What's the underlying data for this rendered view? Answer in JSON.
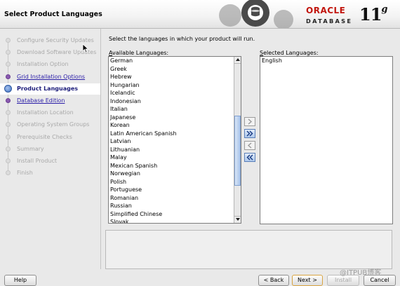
{
  "header": {
    "title": "Select Product Languages",
    "logo_oracle": "ORACLE",
    "logo_database": "DATABASE",
    "logo_version": "11",
    "logo_version_suffix": "g"
  },
  "steps": [
    {
      "label": "Configure Security Updates",
      "state": "disabled"
    },
    {
      "label": "Download Software Updates",
      "state": "disabled"
    },
    {
      "label": "Installation Option",
      "state": "disabled"
    },
    {
      "label": "Grid Installation Options",
      "state": "link"
    },
    {
      "label": "Product Languages",
      "state": "current"
    },
    {
      "label": "Database Edition",
      "state": "link"
    },
    {
      "label": "Installation Location",
      "state": "disabled"
    },
    {
      "label": "Operating System Groups",
      "state": "disabled"
    },
    {
      "label": "Prerequisite Checks",
      "state": "disabled"
    },
    {
      "label": "Summary",
      "state": "disabled"
    },
    {
      "label": "Install Product",
      "state": "disabled"
    },
    {
      "label": "Finish",
      "state": "disabled"
    }
  ],
  "main": {
    "instruction": "Select the languages in which your product will run.",
    "available_label_mnemonic": "A",
    "available_label_rest": "vailable Languages:",
    "selected_label_mnemonic": "S",
    "selected_label_rest": "elected Languages:",
    "available_languages": [
      "German",
      "Greek",
      "Hebrew",
      "Hungarian",
      "Icelandic",
      "Indonesian",
      "Italian",
      "Japanese",
      "Korean",
      "Latin American Spanish",
      "Latvian",
      "Lithuanian",
      "Malay",
      "Mexican Spanish",
      "Norwegian",
      "Polish",
      "Portuguese",
      "Romanian",
      "Russian",
      "Simplified Chinese",
      "Slovak"
    ],
    "selected_languages": [
      "English"
    ],
    "move_buttons": [
      {
        "name": "move-right-button",
        "icon": "chevron-right-icon",
        "enabled": false
      },
      {
        "name": "move-all-right-button",
        "icon": "double-chevron-right-icon",
        "enabled": true
      },
      {
        "name": "move-left-button",
        "icon": "chevron-left-icon",
        "enabled": false
      },
      {
        "name": "move-all-left-button",
        "icon": "double-chevron-left-icon",
        "enabled": true
      }
    ]
  },
  "footer": {
    "help": "Help",
    "back": "< Back",
    "next": "Next >",
    "install": "Install",
    "cancel": "Cancel"
  },
  "watermark": "@ITPUB博客",
  "colors": {
    "oracle_red": "#c2160e",
    "link_blue": "#2b1ea8",
    "current_step_text": "#1c1c7a"
  }
}
